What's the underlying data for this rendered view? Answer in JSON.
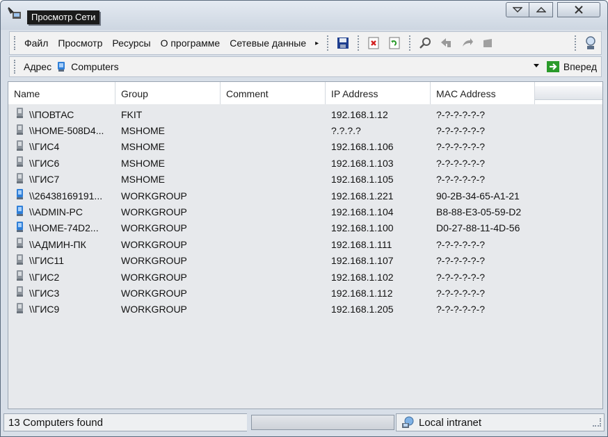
{
  "window": {
    "title": "Просмотр Сети"
  },
  "menubar": {
    "items": [
      {
        "label": "Файл"
      },
      {
        "label": "Просмотр"
      },
      {
        "label": "Ресурсы"
      },
      {
        "label": "О программе"
      },
      {
        "label": "Сетевые данные"
      }
    ],
    "more_glyph": "▸",
    "toolbar_icons": [
      "save-icon",
      "delete-icon",
      "refresh-icon",
      "find-icon",
      "back-icon",
      "forward-icon",
      "stop-icon",
      "network-icon"
    ]
  },
  "addressbar": {
    "label": "Адрес",
    "value": "Computers",
    "go_label": "Вперед"
  },
  "columns": [
    "Name",
    "Group",
    "Comment",
    "IP Address",
    "MAC Address"
  ],
  "rows": [
    {
      "name": "\\\\ПОВТАС",
      "group": "FKIT",
      "comment": "",
      "ip": "192.168.1.12",
      "mac": "?-?-?-?-?-?",
      "icon": "gray"
    },
    {
      "name": "\\\\HOME-508D4...",
      "group": "MSHOME",
      "comment": "",
      "ip": "?.?.?.?",
      "mac": "?-?-?-?-?-?",
      "icon": "gray"
    },
    {
      "name": "\\\\ГИС4",
      "group": "MSHOME",
      "comment": "",
      "ip": "192.168.1.106",
      "mac": "?-?-?-?-?-?",
      "icon": "gray"
    },
    {
      "name": "\\\\ГИС6",
      "group": "MSHOME",
      "comment": "",
      "ip": "192.168.1.103",
      "mac": "?-?-?-?-?-?",
      "icon": "gray"
    },
    {
      "name": "\\\\ГИС7",
      "group": "MSHOME",
      "comment": "",
      "ip": "192.168.1.105",
      "mac": "?-?-?-?-?-?",
      "icon": "gray"
    },
    {
      "name": "\\\\26438169191...",
      "group": "WORKGROUP",
      "comment": "",
      "ip": "192.168.1.221",
      "mac": "90-2B-34-65-A1-21",
      "icon": "blue"
    },
    {
      "name": "\\\\ADMIN-PC",
      "group": "WORKGROUP",
      "comment": "",
      "ip": "192.168.1.104",
      "mac": "B8-88-E3-05-59-D2",
      "icon": "blue"
    },
    {
      "name": "\\\\HOME-74D2...",
      "group": "WORKGROUP",
      "comment": "",
      "ip": "192.168.1.100",
      "mac": "D0-27-88-11-4D-56",
      "icon": "blue"
    },
    {
      "name": "\\\\АДМИН-ПК",
      "group": "WORKGROUP",
      "comment": "",
      "ip": "192.168.1.111",
      "mac": "?-?-?-?-?-?",
      "icon": "gray"
    },
    {
      "name": "\\\\ГИС11",
      "group": "WORKGROUP",
      "comment": "",
      "ip": "192.168.1.107",
      "mac": "?-?-?-?-?-?",
      "icon": "gray"
    },
    {
      "name": "\\\\ГИС2",
      "group": "WORKGROUP",
      "comment": "",
      "ip": "192.168.1.102",
      "mac": "?-?-?-?-?-?",
      "icon": "gray"
    },
    {
      "name": "\\\\ГИС3",
      "group": "WORKGROUP",
      "comment": "",
      "ip": "192.168.1.112",
      "mac": "?-?-?-?-?-?",
      "icon": "gray"
    },
    {
      "name": "\\\\ГИС9",
      "group": "WORKGROUP",
      "comment": "",
      "ip": "192.168.1.205",
      "mac": "?-?-?-?-?-?",
      "icon": "gray"
    }
  ],
  "status": {
    "count_text": "13 Computers found",
    "zone_text": "Local intranet"
  },
  "colors": {
    "titlebar": "#cdd6e1",
    "list_bg": "#e7e9ec",
    "accent_blue": "#2f7fd8",
    "save_blue": "#1f3f8f",
    "delete_red": "#d32222",
    "go_green": "#2a9a2a"
  }
}
